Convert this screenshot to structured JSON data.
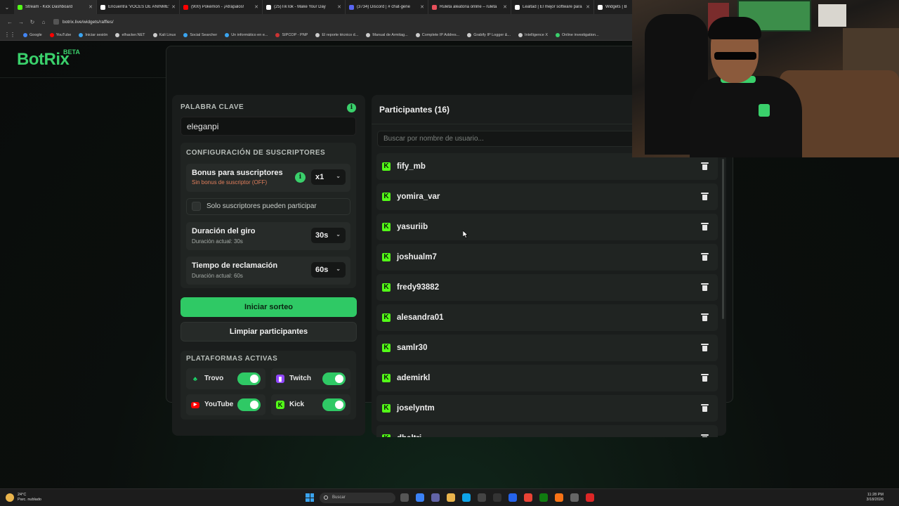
{
  "browser": {
    "tabs": [
      {
        "label": "Stream - Kick Dashboard",
        "color": "#53fc18",
        "active": true
      },
      {
        "label": "Encuentra 'VOCES DE ANINME'",
        "color": "#ffffff",
        "active": false
      },
      {
        "label": "(900) Pokémon - ¡Atrápalos!",
        "color": "#ff0000",
        "active": false
      },
      {
        "label": "(25)TikTok - Make Your Day",
        "color": "#ffffff",
        "active": false
      },
      {
        "label": "(3734) Discord | # chat-gene",
        "color": "#5865f2",
        "active": false
      },
      {
        "label": "Ruleta aleatoria online – ruleta",
        "color": "#e8505b",
        "active": false
      },
      {
        "label": "Lealtad | El mejor software para",
        "color": "#ffffff",
        "active": false
      },
      {
        "label": "Widgets | B",
        "color": "#ffffff",
        "active": false
      }
    ],
    "url": "botrix.live/widgets/raffles/",
    "bookmarks": [
      {
        "label": "Google",
        "color": "#4285f4"
      },
      {
        "label": "YouTube",
        "color": "#ff0000"
      },
      {
        "label": "Iniciar sesión",
        "color": "#3aa4f0"
      },
      {
        "label": "elhacker.NET",
        "color": "#cccccc"
      },
      {
        "label": "Kali Linux",
        "color": "#cccccc"
      },
      {
        "label": "Social Searcher",
        "color": "#3aa4f0"
      },
      {
        "label": "Un informático en e...",
        "color": "#3aa4f0"
      },
      {
        "label": "SIPCOP - PNP",
        "color": "#cc3333"
      },
      {
        "label": "El reporte técnico d...",
        "color": "#cccccc"
      },
      {
        "label": "Manual de Armitag...",
        "color": "#cccccc"
      },
      {
        "label": "Complete IP Addres...",
        "color": "#cccccc"
      },
      {
        "label": "Grabify IP Logger &...",
        "color": "#cccccc"
      },
      {
        "label": "Intelligence X",
        "color": "#cccccc"
      },
      {
        "label": "Online investigation...",
        "color": "#3ad06b"
      }
    ]
  },
  "app": {
    "logo": "BotRix",
    "beta": "BETA"
  },
  "left": {
    "keyword_label": "PALABRA CLAVE",
    "keyword_value": "eleganpi",
    "sub_config_label": "CONFIGURACIÓN DE SUSCRIPTORES",
    "bonus_title": "Bonus para suscriptores",
    "bonus_sub": "Sin bonus de suscriptor (OFF)",
    "bonus_value": "x1",
    "only_subs_label": "Solo suscriptores pueden participar",
    "spin_title": "Duración del giro",
    "spin_sub": "Duración actual: 30s",
    "spin_value": "30s",
    "claim_title": "Tiempo de reclamación",
    "claim_sub": "Duración actual: 60s",
    "claim_value": "60s",
    "start_button": "Iniciar sorteo",
    "clear_button": "Limpiar participantes",
    "platforms_label": "PLATAFORMAS ACTIVAS",
    "platforms": [
      {
        "name": "Trovo",
        "icon": "trovo-icon",
        "color": "#1bd96a",
        "enabled": true
      },
      {
        "name": "Twitch",
        "icon": "twitch-icon",
        "color": "#9146ff",
        "enabled": true
      },
      {
        "name": "YouTube",
        "icon": "youtube-icon",
        "color": "#ff0000",
        "enabled": true
      },
      {
        "name": "Kick",
        "icon": "kick-icon",
        "color": "#53fc18",
        "enabled": true
      }
    ]
  },
  "right": {
    "title": "Participantes (16)",
    "search_placeholder": "Buscar por nombre de usuario...",
    "participants": [
      "fify_mb",
      "yomira_var",
      "yasuriib",
      "joshualm7",
      "fredy93882",
      "alesandra01",
      "samlr30",
      "ademirkl",
      "joselyntm",
      "dhaltri"
    ]
  },
  "taskbar": {
    "weather_temp": "24°C",
    "weather_desc": "Parc. nublado",
    "search_label": "Buscar",
    "time": "11:28 PM",
    "date": "3/18/2026"
  },
  "colors": {
    "accent": "#2fc965",
    "kick": "#53fc18"
  }
}
